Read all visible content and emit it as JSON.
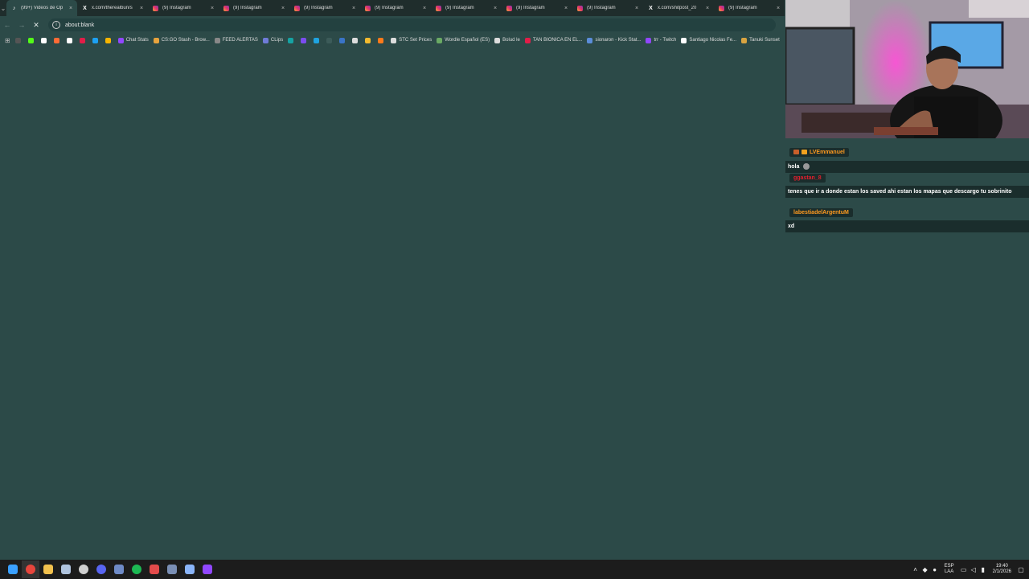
{
  "browser": {
    "tabs": [
      {
        "title": "(99+) Videos de Op",
        "icon": "tiktok-icon",
        "active": true
      },
      {
        "title": "x.com/therealbun/s",
        "icon": "x-icon"
      },
      {
        "title": "(9) Instagram",
        "icon": "instagram-icon"
      },
      {
        "title": "(9) Instagram",
        "icon": "instagram-icon"
      },
      {
        "title": "(9) Instagram",
        "icon": "instagram-icon"
      },
      {
        "title": "(9) Instagram",
        "icon": "instagram-icon"
      },
      {
        "title": "(9) Instagram",
        "icon": "instagram-icon"
      },
      {
        "title": "(9) Instagram",
        "icon": "instagram-icon"
      },
      {
        "title": "(9) Instagram",
        "icon": "instagram-icon"
      },
      {
        "title": "x.com/shitpost_20",
        "icon": "x-icon"
      },
      {
        "title": "(9) Instagram",
        "icon": "instagram-icon"
      }
    ],
    "address": "about:blank",
    "bookmarks": [
      {
        "label": "",
        "color": "#555555"
      },
      {
        "label": "",
        "color": "#53fc18"
      },
      {
        "label": "",
        "color": "#ffffff"
      },
      {
        "label": "",
        "color": "#ff6b35"
      },
      {
        "label": "",
        "color": "#ffffff"
      },
      {
        "label": "",
        "color": "#e21d48"
      },
      {
        "label": "",
        "color": "#1da1f2"
      },
      {
        "label": "",
        "color": "#f7b500"
      },
      {
        "label": "Chat Stats",
        "color": "#9147ff"
      },
      {
        "label": "CS:GO Stash - Brow...",
        "color": "#e8a33d"
      },
      {
        "label": "FEED ALERTAS",
        "color": "#888888"
      },
      {
        "label": "CLips",
        "color": "#6f7bd8"
      },
      {
        "label": "",
        "color": "#16a3a3"
      },
      {
        "label": "",
        "color": "#7b4df0"
      },
      {
        "label": "",
        "color": "#1fa3e0"
      },
      {
        "label": "",
        "color": "#3c5b59"
      },
      {
        "label": "",
        "color": "#3a74c7"
      },
      {
        "label": "",
        "color": "#dddddd"
      },
      {
        "label": "",
        "color": "#f3ba2f"
      },
      {
        "label": "",
        "color": "#ff7a1a"
      },
      {
        "label": "STC Set Prices",
        "color": "#dddddd"
      },
      {
        "label": "Wordle Español (ES)",
        "color": "#6aaa64"
      },
      {
        "label": "Bolud le",
        "color": "#dddddd"
      },
      {
        "label": "TAN BIONICA EN EL...",
        "color": "#e21d48"
      },
      {
        "label": "sionaron - Kick Stat...",
        "color": "#5b8dd9"
      },
      {
        "label": "trr - Twitch",
        "color": "#9147ff"
      },
      {
        "label": "Santiago Nicolas Fe...",
        "color": "#ffffff"
      },
      {
        "label": "Tanuki Sunset",
        "color": "#d9a441"
      }
    ]
  },
  "chat": {
    "messages": [
      {
        "user": "LVEmmanuel",
        "user_color": "#ff9a1f",
        "text": "hola"
      },
      {
        "user": "ggastan_8",
        "user_color": "#e01f2d",
        "text": "tenes que ir a donde estan los saved ahi estan los mapas que descargo tu sobrinito"
      },
      {
        "user": "labestiadelArgentuM",
        "user_color": "#ff9a1f",
        "text": "xd"
      }
    ]
  },
  "taskbar": {
    "apps": [
      {
        "name": "windows-start-icon",
        "color": "#3aa0ff"
      },
      {
        "name": "chrome-icon",
        "color": "#e8453c",
        "active": true
      },
      {
        "name": "file-explorer-icon",
        "color": "#f2c14e"
      },
      {
        "name": "steam-icon",
        "color": "#b0c4de"
      },
      {
        "name": "obs-icon",
        "color": "#d0d0d0"
      },
      {
        "name": "discord-icon",
        "color": "#5865f2"
      },
      {
        "name": "app-window-icon",
        "color": "#6f8bc7"
      },
      {
        "name": "spotify-icon",
        "color": "#1db954"
      },
      {
        "name": "calendar-app-icon",
        "color": "#e34b4b"
      },
      {
        "name": "vpn-icon",
        "color": "#7a8fb5"
      },
      {
        "name": "controller-icon",
        "color": "#8ab4f8"
      },
      {
        "name": "twitch-icon",
        "color": "#9147ff"
      }
    ],
    "tray": {
      "lang_top": "ESP",
      "lang_bottom": "LAA",
      "time": "19:40",
      "date": "2/1/2026"
    }
  }
}
